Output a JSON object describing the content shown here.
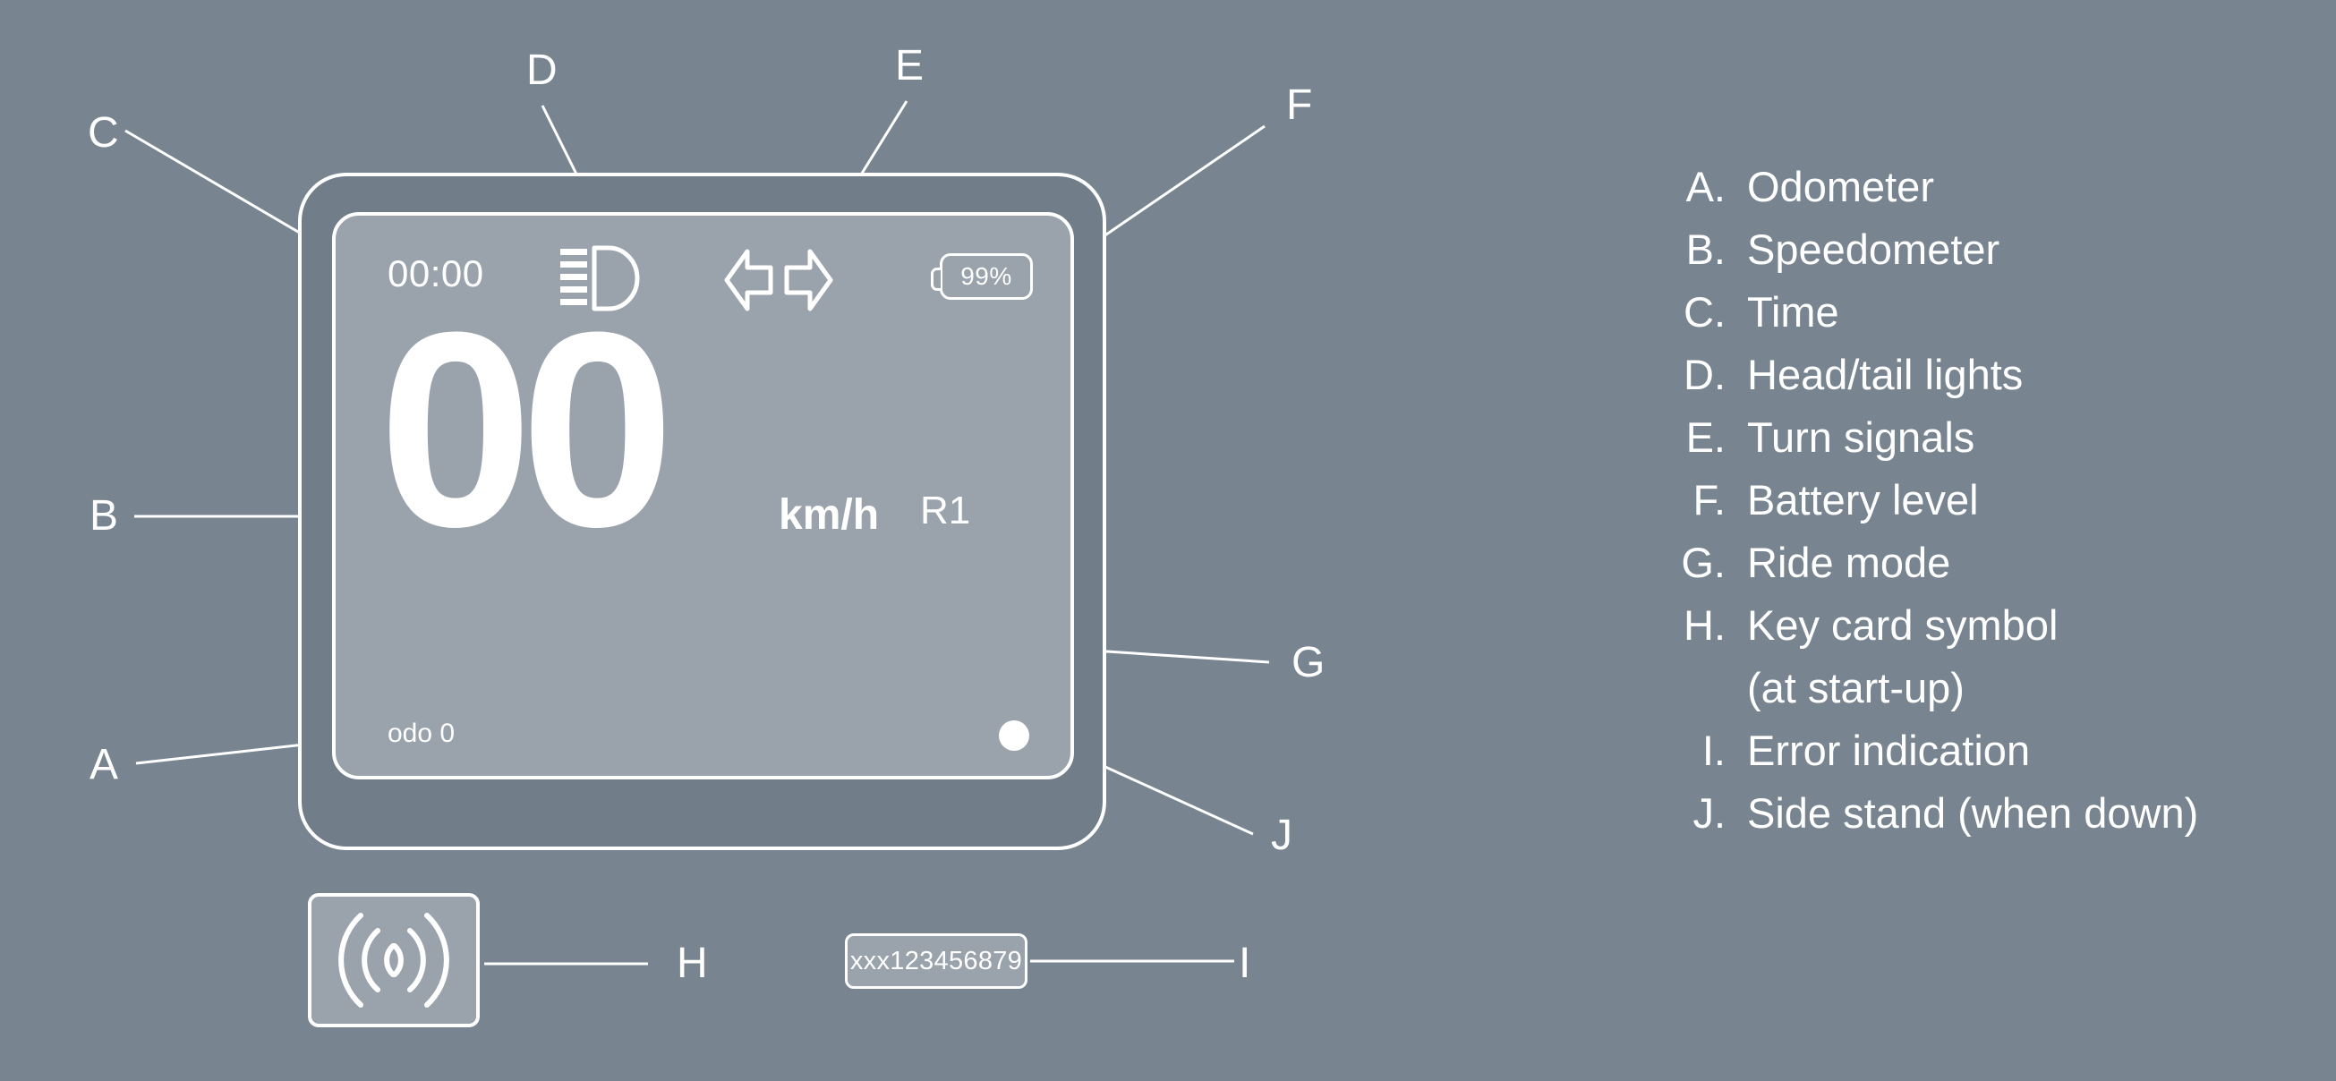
{
  "colors": {
    "background": "#78848f",
    "bezel_fill": "#717e8a",
    "screen_fill": "#9aa3ac",
    "line": "#ffffff",
    "text": "#ffffff"
  },
  "display": {
    "time": "00:00",
    "battery_percent": "99%",
    "speed_value": "00",
    "speed_unit": "km/h",
    "ride_mode": "R1",
    "odometer": "odo 0",
    "headlight_icon": "headlight-beam-icon",
    "turn_left_icon": "turn-signal-left-icon",
    "turn_right_icon": "turn-signal-right-icon",
    "battery_icon": "battery-icon",
    "sidestand_icon": "side-stand-dot-icon"
  },
  "keycard": {
    "icon": "key-card-rfid-waves-icon"
  },
  "error": {
    "code": "xxx123456879"
  },
  "callouts": {
    "a": "A",
    "b": "B",
    "c": "C",
    "d": "D",
    "e": "E",
    "f": "F",
    "g": "G",
    "h": "H",
    "i": "I",
    "j": "J"
  },
  "legend": {
    "items": [
      {
        "key": "A.",
        "label": "Odometer"
      },
      {
        "key": "B.",
        "label": "Speedometer"
      },
      {
        "key": "C.",
        "label": "Time"
      },
      {
        "key": "D.",
        "label": "Head/tail lights"
      },
      {
        "key": "E.",
        "label": "Turn signals"
      },
      {
        "key": "F.",
        "label": "Battery level"
      },
      {
        "key": "G.",
        "label": "Ride mode"
      },
      {
        "key": "H.",
        "label": "Key card symbol"
      },
      {
        "key": "",
        "label": "(at start-up)"
      },
      {
        "key": "I.",
        "label": "Error indication"
      },
      {
        "key": "J.",
        "label": "Side stand (when down)"
      }
    ]
  }
}
